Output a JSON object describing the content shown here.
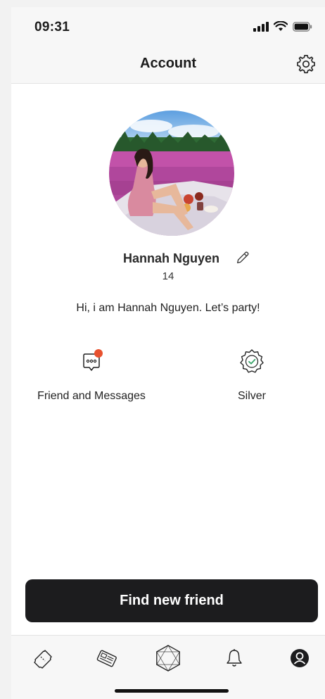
{
  "status_bar": {
    "time": "09:31"
  },
  "header": {
    "title": "Account"
  },
  "profile": {
    "name": "Hannah Nguyen",
    "age": "14",
    "bio": "Hi, i am Hannah Nguyen. Let’s party!"
  },
  "features": [
    {
      "label": "Friend and Messages",
      "icon": "chat-bubble-icon",
      "badge_color": "#e8512e"
    },
    {
      "label": "Silver",
      "icon": "badge-check-icon",
      "accent": "#3aa56a"
    }
  ],
  "cta": {
    "label": "Find new friend"
  },
  "tabbar": {
    "items": [
      {
        "icon": "ticket-icon"
      },
      {
        "icon": "newspaper-icon"
      },
      {
        "icon": "hexagon-icon"
      },
      {
        "icon": "bell-icon"
      },
      {
        "icon": "profile-icon",
        "active": true
      }
    ]
  },
  "colors": {
    "primary_dark": "#1c1c1e",
    "notification": "#e8512e",
    "success": "#3aa56a"
  }
}
